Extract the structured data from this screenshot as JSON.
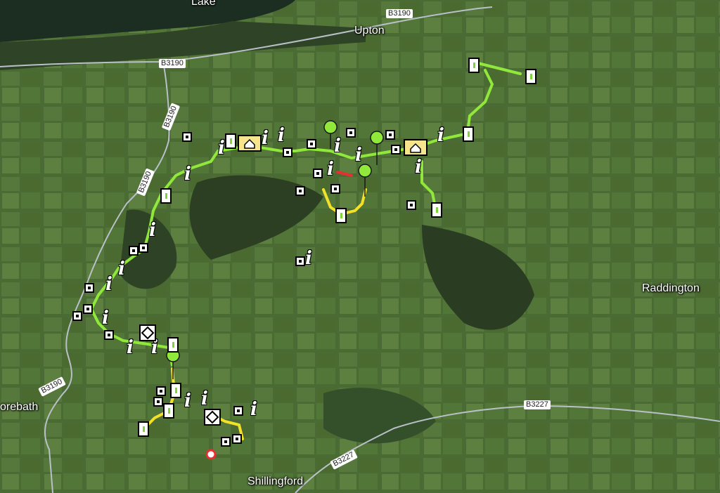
{
  "map": {
    "places": {
      "lake": "Lake",
      "upton": "Upton",
      "raddington": "Raddington",
      "morebath": "orebath",
      "shillingford": "Shillingford"
    },
    "roads": {
      "b3190_top": "B3190",
      "b3190_nw": "B3190",
      "b3190_left1": "B3190",
      "b3190_left2": "B3190",
      "b3190_sw": "B3190",
      "b3227_east": "B3227",
      "b3227_south": "B3227"
    },
    "route_colors": {
      "green": "#8fe83a",
      "yellow": "#f2e02a",
      "red": "#e53030"
    },
    "road_color": "#b9c0c7",
    "icons": [
      "info-icon",
      "square-marker-icon",
      "map-pin-icon",
      "hut-icon",
      "diamond-icon",
      "start-marker-icon"
    ]
  }
}
